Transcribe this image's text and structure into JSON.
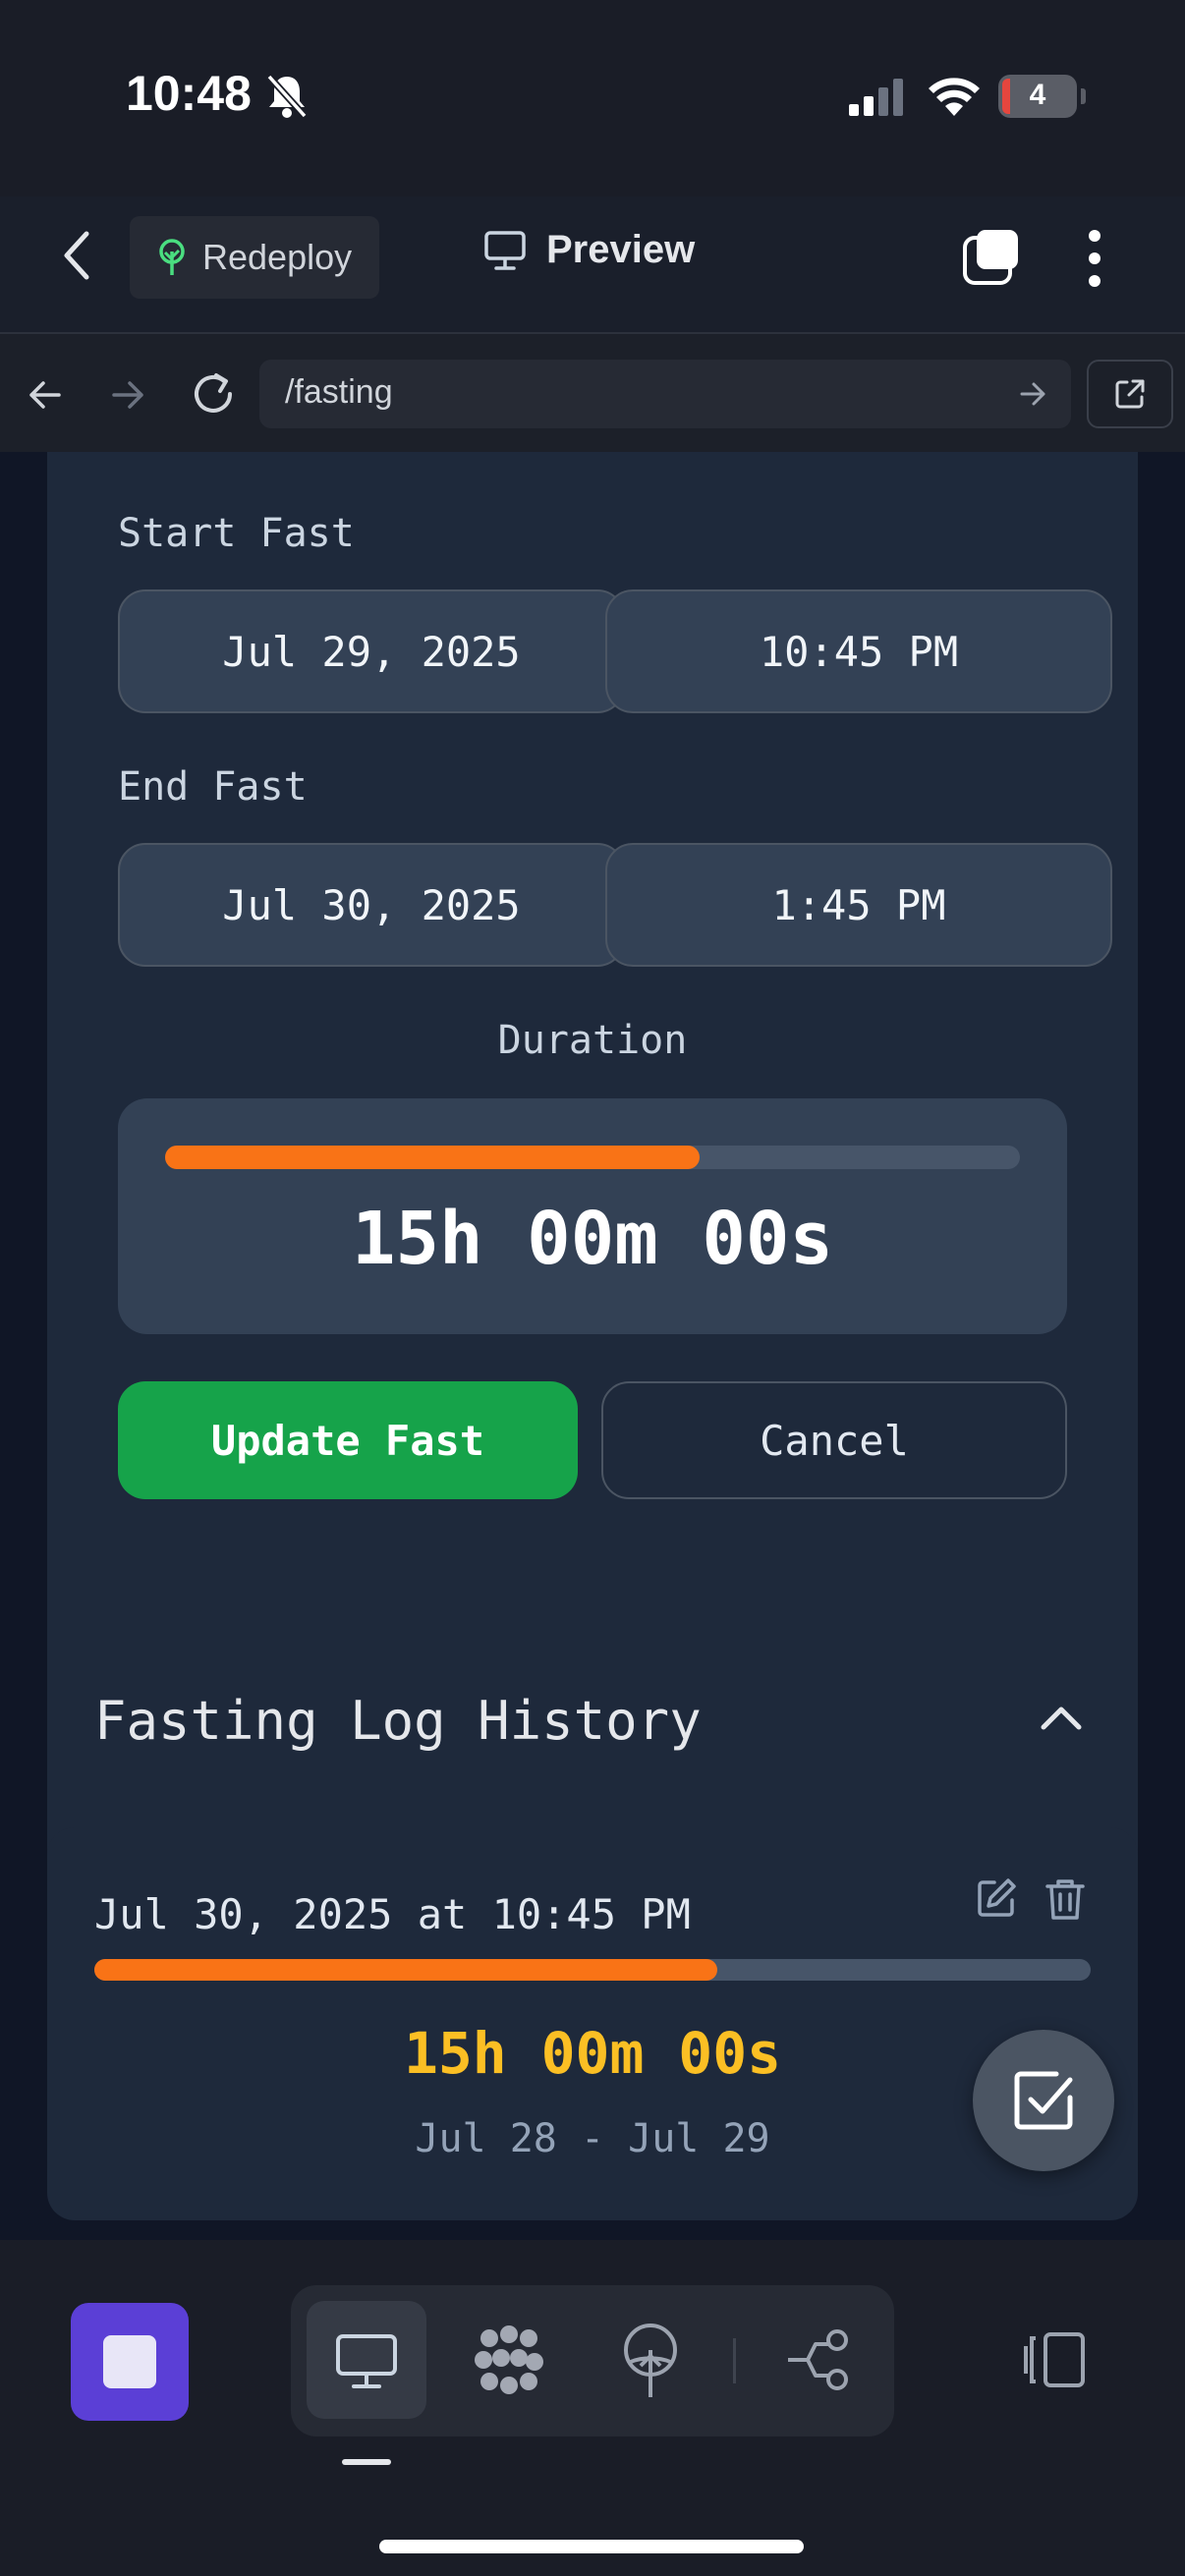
{
  "status_bar": {
    "time": "10:48",
    "battery": "4"
  },
  "header": {
    "redeploy_label": "Redeploy",
    "preview_label": "Preview"
  },
  "url_bar": {
    "path": "/fasting"
  },
  "edit_form": {
    "start_label": "Start Fast",
    "start_date": "Jul 29, 2025",
    "start_time": "10:45 PM",
    "end_label": "End Fast",
    "end_date": "Jul 30, 2025",
    "end_time": "1:45 PM",
    "duration_label": "Duration",
    "duration_value": "15h 00m 00s",
    "duration_progress": 0.625,
    "update_label": "Update Fast",
    "cancel_label": "Cancel"
  },
  "history": {
    "title": "Fasting Log History",
    "entries": [
      {
        "date": "Jul 30, 2025 at 10:45 PM",
        "duration": "15h 00m 00s",
        "range": "Jul 28 - Jul 29",
        "progress": 0.625
      }
    ]
  },
  "colors": {
    "accent_green": "#16a34a",
    "progress_orange": "#f97316",
    "duration_yellow": "#fbbf24",
    "stop_purple": "#5b3fd6"
  },
  "icons": [
    "bell-slash-icon",
    "signal-icon",
    "wifi-icon",
    "battery-icon",
    "chevron-left-icon",
    "tree-icon",
    "monitor-icon",
    "window-icon",
    "more-vertical-icon",
    "arrow-left-icon",
    "arrow-right-icon",
    "reload-icon",
    "external-link-icon",
    "chevron-up-icon",
    "edit-icon",
    "trash-icon",
    "check-square-icon",
    "stop-icon",
    "grid-icon",
    "deploy-icon",
    "share-icon",
    "sidebar-icon"
  ]
}
